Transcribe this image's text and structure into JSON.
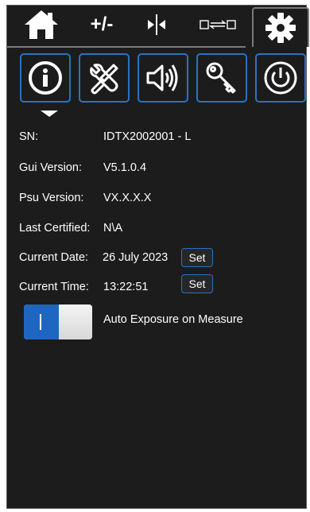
{
  "tabs": {
    "plus_minus_label": "+/-",
    "icons": [
      "home-icon",
      "split-icon",
      "swap-icon",
      "gear-icon"
    ],
    "active": "settings"
  },
  "toolbar": {
    "icons": [
      "info-icon",
      "tools-icon",
      "speaker-icon",
      "key-icon",
      "power-icon"
    ],
    "accent": "#2a72c4"
  },
  "info": {
    "sn_label": "SN:",
    "sn_value": "IDTX2002001 - L",
    "gui_label": "Gui Version:",
    "gui_value": "V5.1.0.4",
    "psu_label": "Psu Version:",
    "psu_value": "VX.X.X.X",
    "cert_label": "Last Certified:",
    "cert_value": "N\\A",
    "date_label": "Current Date:",
    "date_value": "26 July 2023",
    "time_label": "Current Time:",
    "time_value": "13:22:51",
    "set_label": "Set"
  },
  "auto_exposure": {
    "label": "Auto Exposure on Measure",
    "enabled": true,
    "on_color": "#1f66c1"
  }
}
